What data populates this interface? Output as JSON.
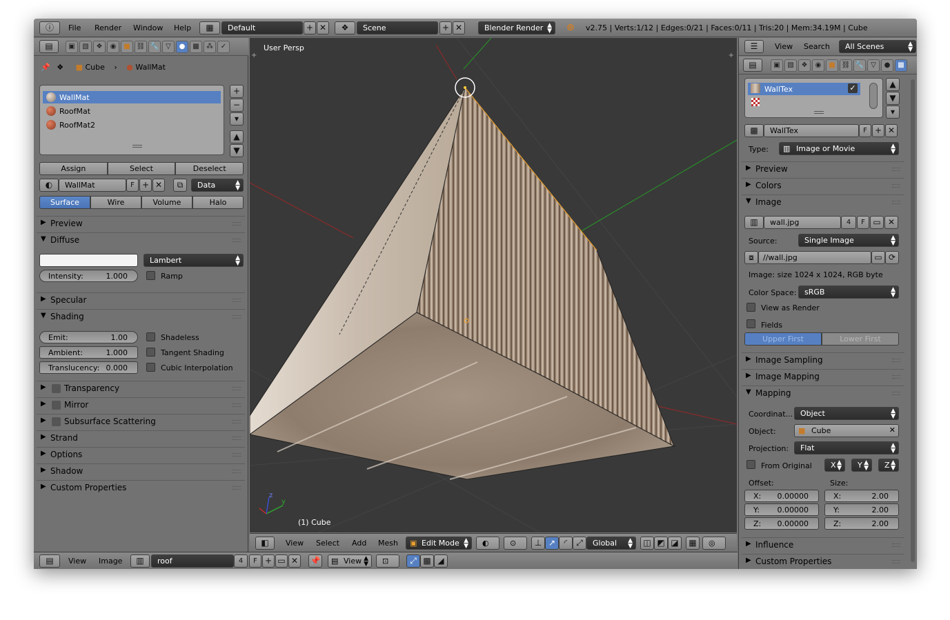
{
  "info_header": {
    "menus": [
      "File",
      "Render",
      "Window",
      "Help"
    ],
    "layout": "Default",
    "scene": "Scene",
    "engine": "Blender Render",
    "stats": "v2.75 | Verts:1/12 | Edges:0/21 | Faces:0/11 | Tris:20 | Mem:34.19M | Cube"
  },
  "outliner_header": {
    "menus": [
      "View",
      "Search"
    ],
    "filter": "All Scenes"
  },
  "material": {
    "breadcrumb": [
      "Cube",
      "WallMat"
    ],
    "slots": [
      "WallMat",
      "RoofMat",
      "RoofMat2"
    ],
    "slot_buttons": [
      "Assign",
      "Select",
      "Deselect"
    ],
    "name": "WallMat",
    "fake_user": "F",
    "link": "Data",
    "tabs": [
      "Surface",
      "Wire",
      "Volume",
      "Halo"
    ],
    "panels": {
      "preview": "Preview",
      "diffuse": "Diffuse",
      "diffuse_shader": "Lambert",
      "intensity_label": "Intensity:",
      "intensity": "1.000",
      "ramp": "Ramp",
      "specular": "Specular",
      "shading": "Shading",
      "emit_label": "Emit:",
      "emit": "1.00",
      "ambient_label": "Ambient:",
      "ambient": "1.000",
      "translucency_label": "Translucency:",
      "translucency": "0.000",
      "shadeless": "Shadeless",
      "tangent": "Tangent Shading",
      "cubic": "Cubic Interpolation",
      "transparency": "Transparency",
      "mirror": "Mirror",
      "sss": "Subsurface Scattering",
      "strand": "Strand",
      "options": "Options",
      "shadow": "Shadow",
      "custom": "Custom Properties"
    }
  },
  "viewport": {
    "view_label": "User Persp",
    "object_label": "(1) Cube",
    "axis_y": "y",
    "axis_z": "z"
  },
  "viewport_header": {
    "menus": [
      "View",
      "Select",
      "Add",
      "Mesh"
    ],
    "mode": "Edit Mode",
    "orientation": "Global"
  },
  "image_header": {
    "menus": [
      "View",
      "Image"
    ],
    "image": "roof",
    "users": "4",
    "fake": "F",
    "view": "View"
  },
  "texture": {
    "slot": "WallTex",
    "name": "WallTex",
    "fake": "F",
    "type_label": "Type:",
    "type": "Image or Movie",
    "panels": {
      "preview": "Preview",
      "colors": "Colors",
      "image": "Image",
      "image_name": "wall.jpg",
      "image_users": "4",
      "image_fake": "F",
      "source_label": "Source:",
      "source": "Single Image",
      "filepath": "//wall.jpg",
      "info": "Image: size 1024 x 1024, RGB byte",
      "colorspace_label": "Color Space:",
      "colorspace": "sRGB",
      "view_as_render": "View as Render",
      "fields": "Fields",
      "upper_first": "Upper First",
      "lower_first": "Lower First",
      "image_sampling": "Image Sampling",
      "image_mapping": "Image Mapping",
      "mapping": "Mapping",
      "coord_label": "Coordinat...",
      "coord": "Object",
      "object_label": "Object:",
      "object": "Cube",
      "projection_label": "Projection:",
      "projection": "Flat",
      "from_original": "From Original",
      "axes": [
        "X",
        "Y",
        "Z"
      ],
      "offset_label": "Offset:",
      "size_label": "Size:",
      "offset": [
        {
          "k": "X:",
          "v": "0.00000"
        },
        {
          "k": "Y:",
          "v": "0.00000"
        },
        {
          "k": "Z:",
          "v": "0.00000"
        }
      ],
      "size": [
        {
          "k": "X:",
          "v": "2.00"
        },
        {
          "k": "Y:",
          "v": "2.00"
        },
        {
          "k": "Z:",
          "v": "2.00"
        }
      ],
      "influence": "Influence",
      "custom": "Custom Properties"
    }
  },
  "colors": {
    "accent": "#5680c2",
    "viewport_bg": "#393939",
    "panel_bg": "#727272"
  }
}
